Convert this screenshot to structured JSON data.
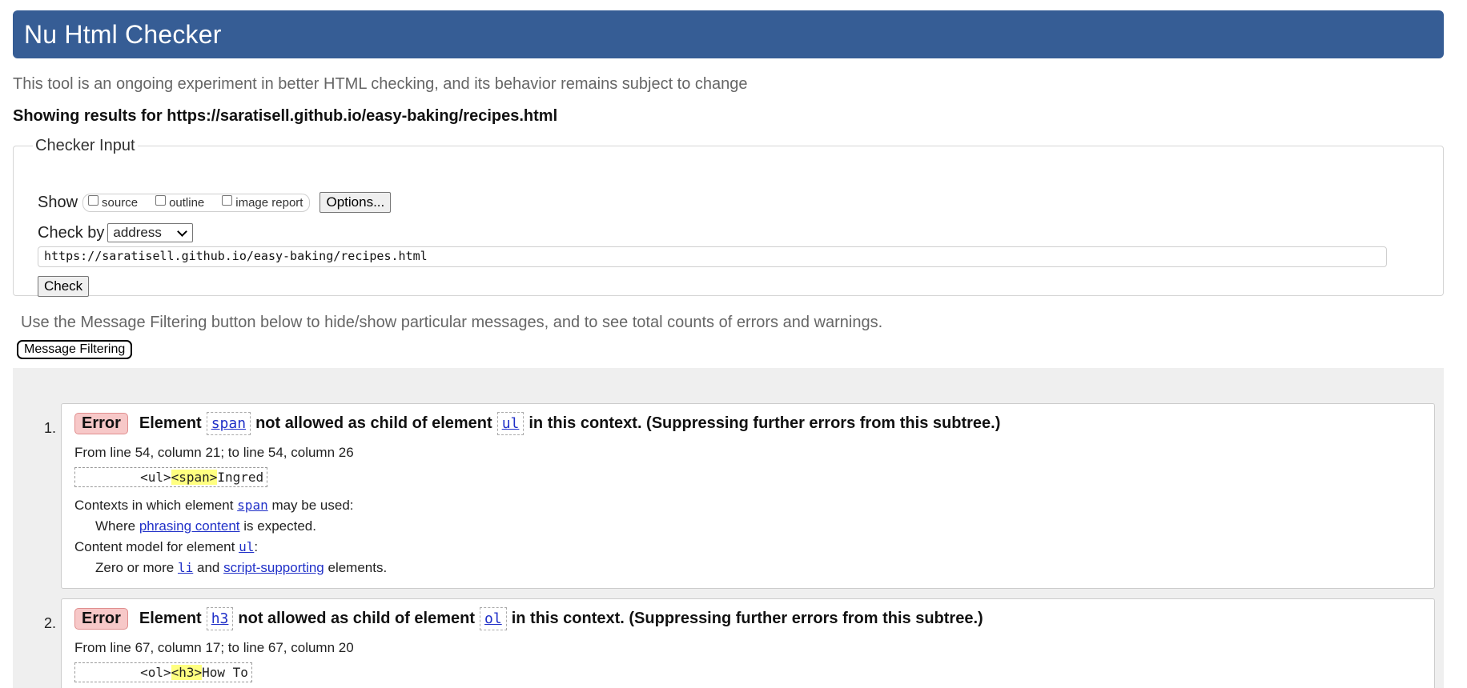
{
  "header": {
    "title": "Nu Html Checker",
    "tagline": "This tool is an ongoing experiment in better HTML checking, and its behavior remains subject to change",
    "showing_results": "Showing results for https://saratisell.github.io/easy-baking/recipes.html"
  },
  "checker_input": {
    "legend": "Checker Input",
    "show_label": "Show",
    "show_options": [
      "source",
      "outline",
      "image report"
    ],
    "options_button": "Options...",
    "check_by_label": "Check by",
    "check_by_value": "address",
    "url_value": "https://saratisell.github.io/easy-baking/recipes.html",
    "check_button": "Check"
  },
  "filtering": {
    "note": "Use the Message Filtering button below to hide/show particular messages, and to see total counts of errors and warnings.",
    "button": "Message Filtering"
  },
  "messages": [
    {
      "number": "1.",
      "type": "Error",
      "t1": "Element",
      "el1": "span",
      "t2": "not allowed as child of element",
      "el2": "ul",
      "t3": "in this context. (Suppressing further errors from this subtree.)",
      "location": "From line 54, column 21; to line 54, column 26",
      "extract_pre": "        <ul>",
      "extract_hl": "<span>",
      "extract_post": "Ingred",
      "ctx_label_pre": "Contexts in which element",
      "ctx_el": "span",
      "ctx_label_post": "may be used:",
      "ctx_where": "Where",
      "ctx_link": "phrasing content",
      "ctx_where_post": "is expected.",
      "cm_label_pre": "Content model for element",
      "cm_el": "ul",
      "cm_label_post": ":",
      "cm_pre": "Zero or more",
      "cm_el2": "li",
      "cm_and": "and",
      "cm_link": "script-supporting",
      "cm_post": "elements."
    },
    {
      "number": "2.",
      "type": "Error",
      "t1": "Element",
      "el1": "h3",
      "t2": "not allowed as child of element",
      "el2": "ol",
      "t3": "in this context. (Suppressing further errors from this subtree.)",
      "location": "From line 67, column 17; to line 67, column 20",
      "extract_pre": "        <ol>",
      "extract_hl": "<h3>",
      "extract_post": "How To"
    }
  ]
}
